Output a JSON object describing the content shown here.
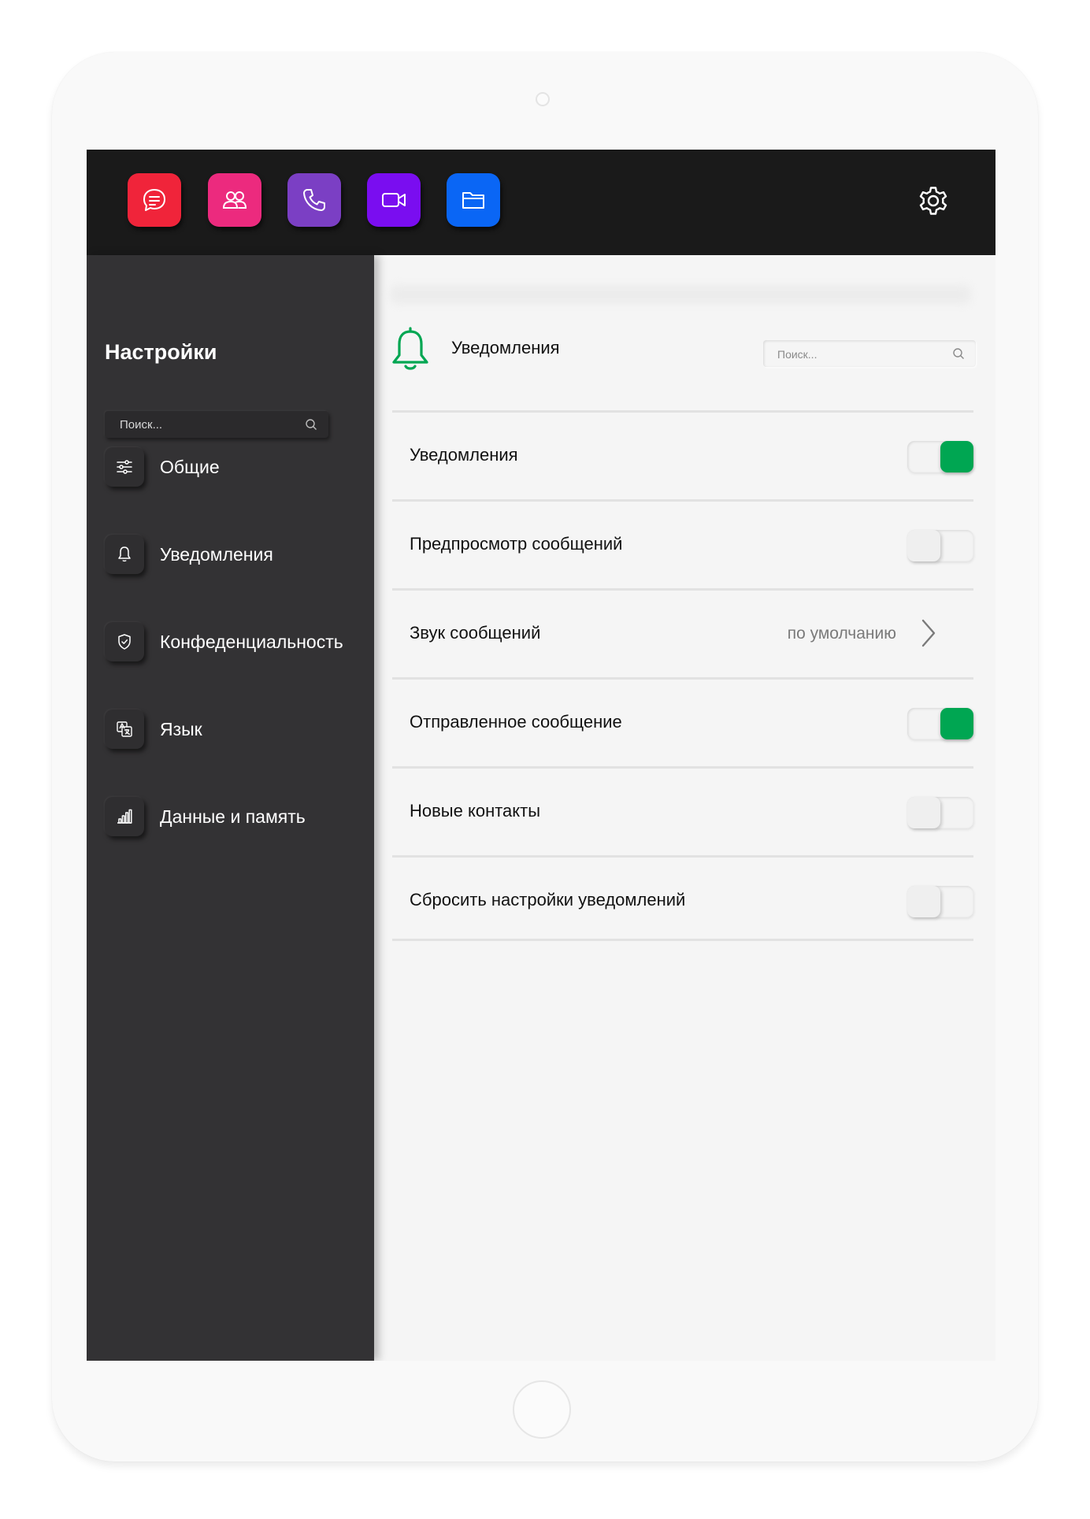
{
  "topbar": {
    "apps": [
      {
        "name": "chat-icon",
        "color": "#f0243a"
      },
      {
        "name": "contacts-icon",
        "color": "#ec2a7e"
      },
      {
        "name": "phone-icon",
        "color": "#7b3fc4"
      },
      {
        "name": "video-icon",
        "color": "#7a0df0"
      },
      {
        "name": "folder-icon",
        "color": "#0a66f5"
      }
    ],
    "settings_icon": "gear-icon"
  },
  "sidebar": {
    "title": "Настройки",
    "search_placeholder": "Поиск...",
    "items": [
      {
        "label": "Общие",
        "icon": "sliders-icon"
      },
      {
        "label": "Уведомления",
        "icon": "bell-icon"
      },
      {
        "label": "Конфеденциальность",
        "icon": "shield-icon"
      },
      {
        "label": "Язык",
        "icon": "translate-icon"
      },
      {
        "label": "Данные и память",
        "icon": "bar-chart-icon"
      }
    ]
  },
  "content": {
    "title": "Уведомления",
    "header_icon": "bell-icon",
    "search_placeholder": "Поиск...",
    "accent_color": "#00a652",
    "rows": [
      {
        "label": "Уведомления",
        "toggle": true
      },
      {
        "label": "Предпросмотр сообщений",
        "toggle": false
      },
      {
        "label": "Звук сообщений",
        "value": "по умолчанию"
      },
      {
        "label": "Отправленное сообщение",
        "toggle": true
      },
      {
        "label": "Новые контакты",
        "toggle": false
      },
      {
        "label": "Сбросить настройки уведомлений",
        "toggle": false
      }
    ]
  }
}
